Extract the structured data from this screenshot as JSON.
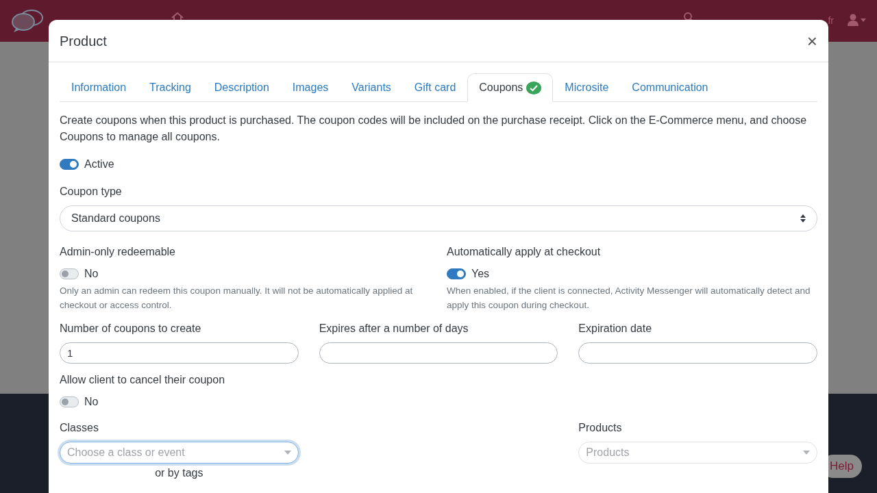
{
  "navbar": {
    "language": "fr"
  },
  "modal": {
    "title": "Product",
    "close": "×",
    "tabs": [
      {
        "label": "Information",
        "selected": false,
        "complete": false
      },
      {
        "label": "Tracking",
        "selected": false,
        "complete": false
      },
      {
        "label": "Description",
        "selected": false,
        "complete": false
      },
      {
        "label": "Images",
        "selected": false,
        "complete": false
      },
      {
        "label": "Variants",
        "selected": false,
        "complete": false
      },
      {
        "label": "Gift card",
        "selected": false,
        "complete": false
      },
      {
        "label": "Coupons",
        "selected": true,
        "complete": true
      },
      {
        "label": "Microsite",
        "selected": false,
        "complete": false
      },
      {
        "label": "Communication",
        "selected": false,
        "complete": false
      }
    ],
    "intro": "Create coupons when this product is purchased. The coupon codes will be included on the purchase receipt. Click on the E-Commerce menu, and choose Coupons to manage all coupons.",
    "active": {
      "label": "Active",
      "on": true
    },
    "coupon_type": {
      "label": "Coupon type",
      "value": "Standard coupons"
    },
    "options": [
      {
        "label": "Admin-only redeemable",
        "on": false,
        "state_label": "No",
        "help": "Only an admin can redeem this coupon manually. It will not be automatically applied at checkout or access control."
      },
      {
        "label": "Automatically apply at checkout",
        "on": true,
        "state_label": "Yes",
        "help": "When enabled, if the client is connected, Activity Messenger will automatically detect and apply this coupon during checkout."
      }
    ],
    "fields": [
      {
        "label": "Number of coupons to create",
        "value": "1"
      },
      {
        "label": "Expires after a number of days"
      },
      {
        "label": "Expiration date"
      }
    ],
    "allow_cancel": {
      "label": "Allow client to cancel their coupon",
      "on": false,
      "state_label": "No"
    },
    "classes": {
      "label": "Classes",
      "placeholder": "Choose a class or event",
      "focused": true
    },
    "or_by_tags": "or by tags",
    "products": {
      "label": "Products",
      "placeholder": "Products",
      "focused": false
    }
  },
  "help_button": "Help"
}
